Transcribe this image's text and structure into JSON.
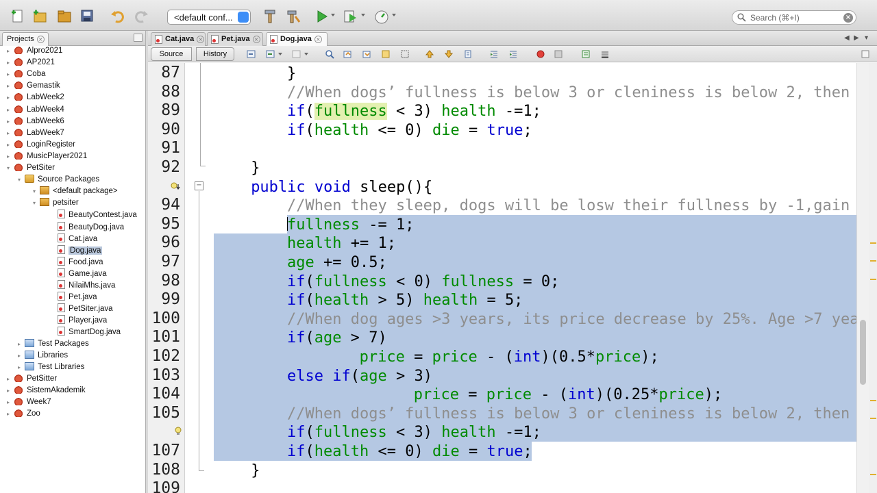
{
  "toolbar": {
    "config_value": "<default conf...",
    "search_placeholder": "Search (⌘+I)",
    "icons": [
      "new-file-icon",
      "new-project-icon",
      "open-project-icon",
      "save-all-icon",
      "undo-icon",
      "redo-icon",
      "config-select",
      "clean-build-icon",
      "build-icon",
      "run-icon",
      "debug-icon",
      "profile-icon",
      "search-icon"
    ]
  },
  "projects": {
    "tab_label": "Projects",
    "tree": [
      {
        "label": "Alpro2021",
        "type": "project",
        "depth": 0
      },
      {
        "label": "AP2021",
        "type": "project",
        "depth": 0
      },
      {
        "label": "Coba",
        "type": "project",
        "depth": 0
      },
      {
        "label": "Gemastik",
        "type": "project",
        "depth": 0
      },
      {
        "label": "LabWeek2",
        "type": "project",
        "depth": 0
      },
      {
        "label": "LabWeek4",
        "type": "project",
        "depth": 0
      },
      {
        "label": "LabWeek6",
        "type": "project",
        "depth": 0
      },
      {
        "label": "LabWeek7",
        "type": "project",
        "depth": 0
      },
      {
        "label": "LoginRegister",
        "type": "project",
        "depth": 0
      },
      {
        "label": "MusicPlayer2021",
        "type": "project",
        "depth": 0
      },
      {
        "label": "PetSiter",
        "type": "project",
        "depth": 0
      },
      {
        "label": "Source Packages",
        "type": "pkgdir",
        "depth": 1
      },
      {
        "label": "<default package>",
        "type": "pkg",
        "depth": 2
      },
      {
        "label": "petsiter",
        "type": "pkg",
        "depth": 2
      },
      {
        "label": "BeautyContest.java",
        "type": "java",
        "depth": 3
      },
      {
        "label": "BeautyDog.java",
        "type": "java",
        "depth": 3
      },
      {
        "label": "Cat.java",
        "type": "java",
        "depth": 3
      },
      {
        "label": "Dog.java",
        "type": "java",
        "depth": 3
      },
      {
        "label": "Food.java",
        "type": "java",
        "depth": 3
      },
      {
        "label": "Game.java",
        "type": "java",
        "depth": 3
      },
      {
        "label": "NilaiMhs.java",
        "type": "java",
        "depth": 3
      },
      {
        "label": "Pet.java",
        "type": "java",
        "depth": 3
      },
      {
        "label": "PetSiter.java",
        "type": "java",
        "depth": 3
      },
      {
        "label": "Player.java",
        "type": "java",
        "depth": 3
      },
      {
        "label": "SmartDog.java",
        "type": "java",
        "depth": 3
      },
      {
        "label": "Test Packages",
        "type": "lib",
        "depth": 1
      },
      {
        "label": "Libraries",
        "type": "lib",
        "depth": 1
      },
      {
        "label": "Test Libraries",
        "type": "lib",
        "depth": 1
      },
      {
        "label": "PetSitter",
        "type": "project",
        "depth": 0
      },
      {
        "label": "SistemAkademik",
        "type": "project",
        "depth": 0
      },
      {
        "label": "Week7",
        "type": "project",
        "depth": 0
      },
      {
        "label": "Zoo",
        "type": "project",
        "depth": 0
      }
    ],
    "selected": "Dog.java"
  },
  "editor": {
    "tabs": [
      {
        "label": "Cat.java",
        "active": false
      },
      {
        "label": "Pet.java",
        "active": false
      },
      {
        "label": "Dog.java",
        "active": true
      }
    ],
    "view_source_label": "Source",
    "view_history_label": "History",
    "lines": [
      {
        "num": "87",
        "indent": 0,
        "parts": [
          [
            "plain",
            "}"
          ]
        ]
      },
      {
        "num": "88",
        "indent": 0,
        "parts": [
          [
            "cmt",
            "//When dogs’ fullness is below 3 or cleniness is below 2, then"
          ]
        ]
      },
      {
        "num": "89",
        "indent": 0,
        "parts": [
          [
            "kw",
            "if"
          ],
          [
            "plain",
            "("
          ],
          [
            "fld",
            "fullness"
          ],
          [
            "plain",
            " < 3) "
          ],
          [
            "fld",
            "health"
          ],
          [
            "plain",
            " -=1;"
          ]
        ]
      },
      {
        "num": "90",
        "indent": 0,
        "parts": [
          [
            "kw",
            "if"
          ],
          [
            "plain",
            "("
          ],
          [
            "fld",
            "health"
          ],
          [
            "plain",
            " <= 0) "
          ],
          [
            "fld",
            "die"
          ],
          [
            "plain",
            " = "
          ],
          [
            "kw",
            "true"
          ],
          [
            "plain",
            ";"
          ]
        ]
      },
      {
        "num": "91",
        "indent": 0,
        "parts": []
      },
      {
        "num": "92",
        "indent": -2,
        "parts": [
          [
            "plain",
            "}"
          ]
        ]
      },
      {
        "num": "",
        "indent": -2,
        "parts": [
          [
            "kw",
            "public void"
          ],
          [
            "plain",
            " sleep(){"
          ]
        ]
      },
      {
        "num": "94",
        "indent": 0,
        "parts": [
          [
            "cmt",
            "//When they sleep, dogs will be losw their fullness by -1,gain"
          ]
        ]
      },
      {
        "num": "95",
        "indent": 0,
        "parts": [
          [
            "fld",
            "fullness"
          ],
          [
            "plain",
            " -= 1;"
          ]
        ]
      },
      {
        "num": "96",
        "indent": 0,
        "parts": [
          [
            "fld",
            "health"
          ],
          [
            "plain",
            " += 1;"
          ]
        ]
      },
      {
        "num": "97",
        "indent": 0,
        "parts": [
          [
            "fld",
            "age"
          ],
          [
            "plain",
            " += 0.5;"
          ]
        ]
      },
      {
        "num": "98",
        "indent": 0,
        "parts": [
          [
            "kw",
            "if"
          ],
          [
            "plain",
            "("
          ],
          [
            "fld",
            "fullness"
          ],
          [
            "plain",
            " < 0) "
          ],
          [
            "fld",
            "fullness"
          ],
          [
            "plain",
            " = 0;"
          ]
        ]
      },
      {
        "num": "99",
        "indent": 0,
        "parts": [
          [
            "kw",
            "if"
          ],
          [
            "plain",
            "("
          ],
          [
            "fld",
            "health"
          ],
          [
            "plain",
            " > 5) "
          ],
          [
            "fld",
            "health"
          ],
          [
            "plain",
            " = 5;"
          ]
        ]
      },
      {
        "num": "100",
        "indent": 0,
        "parts": [
          [
            "cmt",
            "//When dog ages >3 years, its price decrease by 25%. Age >7 yea"
          ]
        ]
      },
      {
        "num": "101",
        "indent": 0,
        "parts": [
          [
            "kw",
            "if"
          ],
          [
            "plain",
            "("
          ],
          [
            "fld",
            "age"
          ],
          [
            "plain",
            " > 7)"
          ]
        ]
      },
      {
        "num": "102",
        "indent": 4,
        "parts": [
          [
            "fld",
            "price"
          ],
          [
            "plain",
            " = "
          ],
          [
            "fld",
            "price"
          ],
          [
            "plain",
            " - ("
          ],
          [
            "kw",
            "int"
          ],
          [
            "plain",
            ")(0.5*"
          ],
          [
            "fld",
            "price"
          ],
          [
            "plain",
            ");"
          ]
        ]
      },
      {
        "num": "103",
        "indent": 0,
        "parts": [
          [
            "kw",
            "else if"
          ],
          [
            "plain",
            "("
          ],
          [
            "fld",
            "age"
          ],
          [
            "plain",
            " > 3)"
          ]
        ]
      },
      {
        "num": "104",
        "indent": 7,
        "parts": [
          [
            "fld",
            "price"
          ],
          [
            "plain",
            " = "
          ],
          [
            "fld",
            "price"
          ],
          [
            "plain",
            " - ("
          ],
          [
            "kw",
            "int"
          ],
          [
            "plain",
            ")(0.25*"
          ],
          [
            "fld",
            "price"
          ],
          [
            "plain",
            ");"
          ]
        ]
      },
      {
        "num": "105",
        "indent": 0,
        "parts": [
          [
            "cmt",
            "//When dogs’ fullness is below 3 or cleniness is below 2, then"
          ]
        ]
      },
      {
        "num": "",
        "indent": 0,
        "parts": [
          [
            "kw",
            "if"
          ],
          [
            "plain",
            "("
          ],
          [
            "fld",
            "fullness"
          ],
          [
            "plain",
            " < 3) "
          ],
          [
            "fld",
            "health"
          ],
          [
            "plain",
            " -=1;"
          ]
        ]
      },
      {
        "num": "107",
        "indent": 0,
        "parts": [
          [
            "kw",
            "if"
          ],
          [
            "plain",
            "("
          ],
          [
            "fld",
            "health"
          ],
          [
            "plain",
            " <= 0) "
          ],
          [
            "fld",
            "die"
          ],
          [
            "plain",
            " = "
          ],
          [
            "kw",
            "true"
          ],
          [
            "plain",
            ";"
          ]
        ]
      },
      {
        "num": "108",
        "indent": -2,
        "parts": [
          [
            "plain",
            "}"
          ]
        ]
      },
      {
        "num": "109",
        "indent": 0,
        "parts": []
      }
    ]
  },
  "colors": {
    "keyword": "#0000d0",
    "field": "#008a00",
    "comment": "#8e8e8e",
    "selection": "#b5c8e3"
  }
}
